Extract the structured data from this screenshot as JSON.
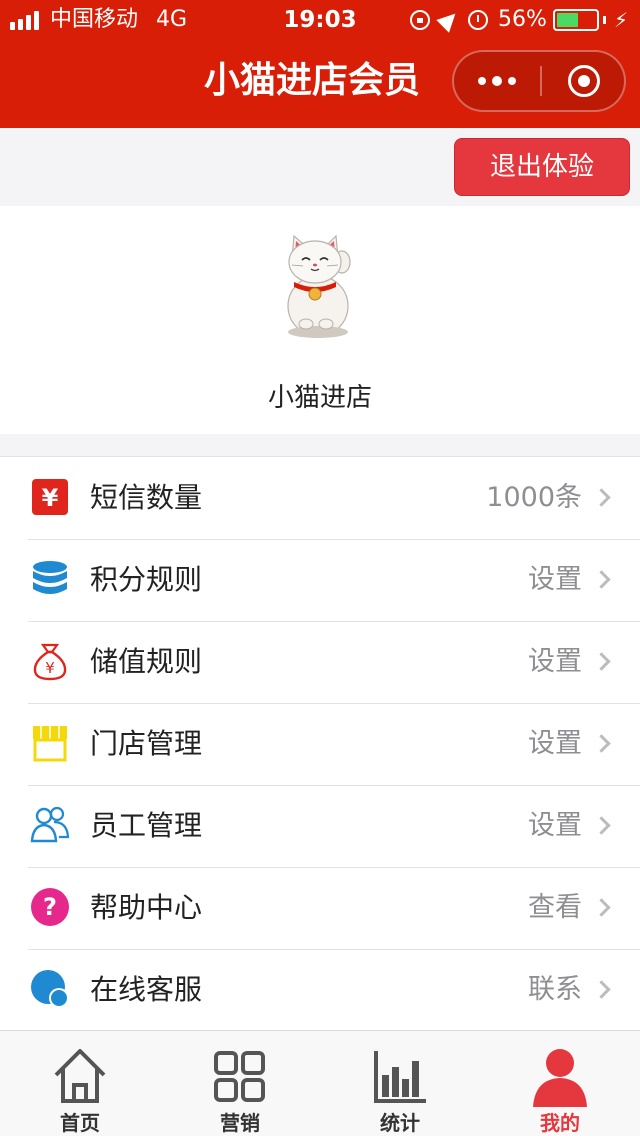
{
  "status_bar": {
    "carrier": "中国移动",
    "network": "4G",
    "time": "19:03",
    "battery_percent": "56%",
    "battery_level": 0.56
  },
  "nav": {
    "title": "小猫进店会员"
  },
  "exit_label": "退出体验",
  "profile": {
    "store_name": "小猫进店"
  },
  "menu": [
    {
      "label": "短信数量",
      "value": "1000条",
      "icon": "sms-yen-icon",
      "color": "#e0261c"
    },
    {
      "label": "积分规则",
      "value": "设置",
      "icon": "database-icon",
      "color": "#1f8ad2"
    },
    {
      "label": "储值规则",
      "value": "设置",
      "icon": "money-bag-icon",
      "color": "#e0261c"
    },
    {
      "label": "门店管理",
      "value": "设置",
      "icon": "storefront-icon",
      "color": "#f5d80a"
    },
    {
      "label": "员工管理",
      "value": "设置",
      "icon": "staff-icon",
      "color": "#1f8ad2"
    },
    {
      "label": "帮助中心",
      "value": "查看",
      "icon": "help-icon",
      "color": "#e6288c"
    },
    {
      "label": "在线客服",
      "value": "联系",
      "icon": "chat-icon",
      "color": "#1f8ad2"
    }
  ],
  "tabs": [
    {
      "label": "首页",
      "icon": "home-icon",
      "active": false
    },
    {
      "label": "营销",
      "icon": "grid-icon",
      "active": false
    },
    {
      "label": "统计",
      "icon": "bar-chart-icon",
      "active": false
    },
    {
      "label": "我的",
      "icon": "user-icon",
      "active": true
    }
  ],
  "colors": {
    "brand_red": "#d81e06",
    "exit_button": "#e5373e",
    "active_tab": "#e5373e"
  }
}
